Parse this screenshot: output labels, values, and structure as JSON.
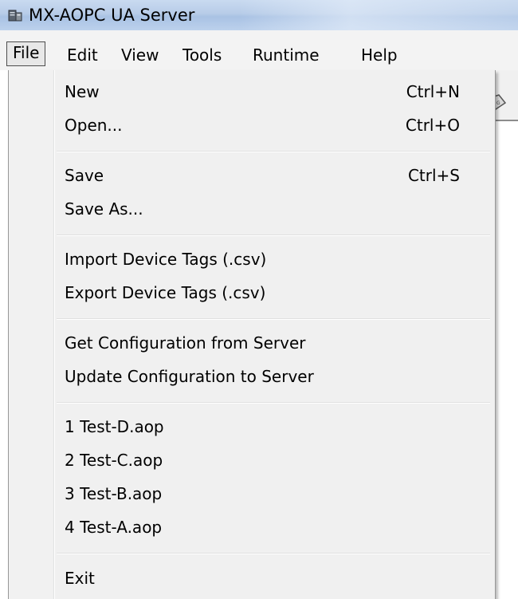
{
  "window": {
    "title": "MX-AOPC UA Server",
    "icon": "app-server-icon"
  },
  "menubar": {
    "items": [
      {
        "label": "File",
        "active": true
      },
      {
        "label": "Edit"
      },
      {
        "label": "View"
      },
      {
        "label": "Tools"
      },
      {
        "label": "Runtime"
      },
      {
        "label": "Help"
      }
    ]
  },
  "file_menu": {
    "groups": [
      [
        {
          "label": "New",
          "shortcut": "Ctrl+N"
        },
        {
          "label": "Open...",
          "shortcut": "Ctrl+O"
        }
      ],
      [
        {
          "label": "Save",
          "shortcut": "Ctrl+S"
        },
        {
          "label": "Save As...",
          "shortcut": ""
        }
      ],
      [
        {
          "label": "Import Device Tags (.csv)",
          "shortcut": ""
        },
        {
          "label": "Export Device Tags (.csv)",
          "shortcut": ""
        }
      ],
      [
        {
          "label": "Get Configuration from Server",
          "shortcut": ""
        },
        {
          "label": "Update Configuration to Server",
          "shortcut": ""
        }
      ],
      [
        {
          "label": "1 Test-D.aop",
          "shortcut": ""
        },
        {
          "label": "2 Test-C.aop",
          "shortcut": ""
        },
        {
          "label": "3 Test-B.aop",
          "shortcut": ""
        },
        {
          "label": "4 Test-A.aop",
          "shortcut": ""
        }
      ],
      [
        {
          "label": "Exit",
          "shortcut": ""
        }
      ]
    ]
  },
  "toolbar": {
    "partial_icon": "tag-icon"
  }
}
